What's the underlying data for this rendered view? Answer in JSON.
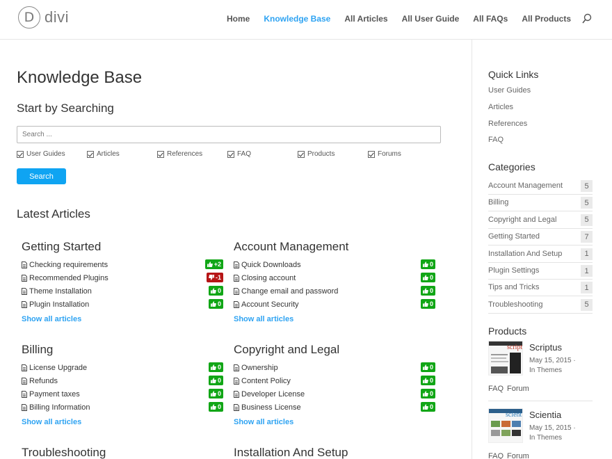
{
  "brand": {
    "logo_letter": "D",
    "logo_text": "divi"
  },
  "nav": {
    "items": [
      {
        "label": "Home",
        "active": false
      },
      {
        "label": "Knowledge Base",
        "active": true
      },
      {
        "label": "All Articles",
        "active": false
      },
      {
        "label": "All User Guide",
        "active": false
      },
      {
        "label": "All FAQs",
        "active": false
      },
      {
        "label": "All Products",
        "active": false
      }
    ]
  },
  "main": {
    "title": "Knowledge Base",
    "search_heading": "Start by Searching",
    "search_placeholder": "Search ...",
    "filters": [
      "User Guides",
      "Articles",
      "References",
      "FAQ",
      "Products",
      "Forums"
    ],
    "search_button": "Search",
    "latest_heading": "Latest Articles",
    "show_all_label": "Show all articles",
    "categories": [
      {
        "title": "Getting Started",
        "articles": [
          {
            "title": "Checking requirements",
            "vote": "+2",
            "type": "up"
          },
          {
            "title": "Recommended Plugins",
            "vote": "-1",
            "type": "down"
          },
          {
            "title": "Theme Installation",
            "vote": "0",
            "type": "up"
          },
          {
            "title": "Plugin Installation",
            "vote": "0",
            "type": "up"
          }
        ]
      },
      {
        "title": "Account Management",
        "articles": [
          {
            "title": "Quick Downloads",
            "vote": "0",
            "type": "up"
          },
          {
            "title": "Closing account",
            "vote": "0",
            "type": "up"
          },
          {
            "title": "Change email and password",
            "vote": "0",
            "type": "up"
          },
          {
            "title": "Account Security",
            "vote": "0",
            "type": "up"
          }
        ]
      },
      {
        "title": "Billing",
        "articles": [
          {
            "title": "License Upgrade",
            "vote": "0",
            "type": "up"
          },
          {
            "title": "Refunds",
            "vote": "0",
            "type": "up"
          },
          {
            "title": "Payment taxes",
            "vote": "0",
            "type": "up"
          },
          {
            "title": "Billing Information",
            "vote": "0",
            "type": "up"
          }
        ]
      },
      {
        "title": "Copyright and Legal",
        "articles": [
          {
            "title": "Ownership",
            "vote": "0",
            "type": "up"
          },
          {
            "title": "Content Policy",
            "vote": "0",
            "type": "up"
          },
          {
            "title": "Developer License",
            "vote": "0",
            "type": "up"
          },
          {
            "title": "Business License",
            "vote": "0",
            "type": "up"
          }
        ]
      },
      {
        "title": "Troubleshooting",
        "articles": []
      },
      {
        "title": "Installation And Setup",
        "articles": []
      }
    ]
  },
  "sidebar": {
    "quick_links_heading": "Quick Links",
    "quick_links": [
      "User Guides",
      "Articles",
      "References",
      "FAQ"
    ],
    "categories_heading": "Categories",
    "categories": [
      {
        "name": "Account Management",
        "count": "5"
      },
      {
        "name": "Billing",
        "count": "5"
      },
      {
        "name": "Copyright and Legal",
        "count": "5"
      },
      {
        "name": "Getting Started",
        "count": "7"
      },
      {
        "name": "Installation And Setup",
        "count": "1"
      },
      {
        "name": "Plugin Settings",
        "count": "1"
      },
      {
        "name": "Tips and Tricks",
        "count": "1"
      },
      {
        "name": "Troubleshooting",
        "count": "5"
      }
    ],
    "products_heading": "Products",
    "products": [
      {
        "name": "Scriptus",
        "date": "May 15, 2015 ·",
        "in": "In Themes",
        "links": [
          "FAQ",
          "Forum"
        ],
        "thumb_word": "script"
      },
      {
        "name": "Scientia",
        "date": "May 15, 2015 ·",
        "in": "In Themes",
        "links": [
          "FAQ",
          "Forum"
        ],
        "thumb_word": "scient"
      }
    ]
  },
  "colors": {
    "accent": "#2ea3f2",
    "button": "#0fa4f2",
    "vote_up": "#11a616",
    "vote_down": "#b61516"
  }
}
